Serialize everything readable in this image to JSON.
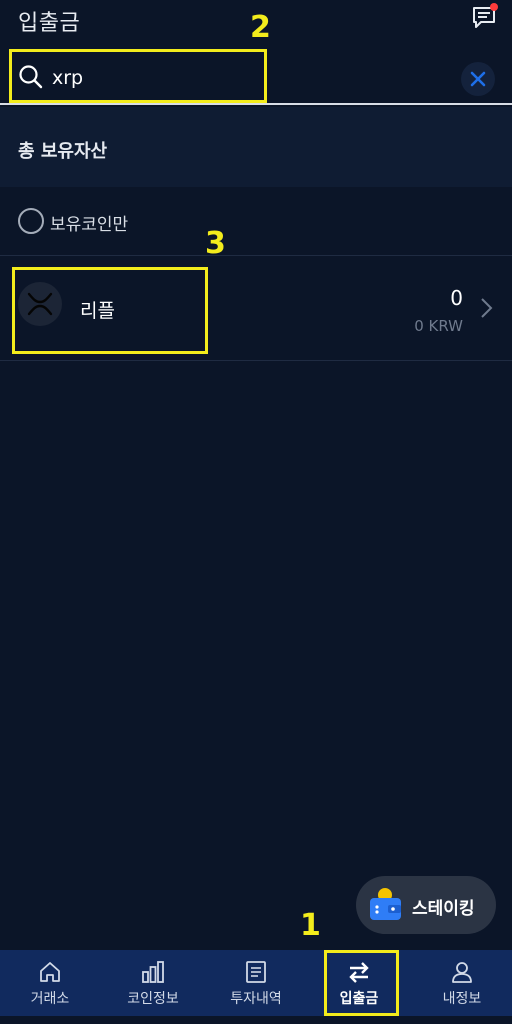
{
  "header": {
    "title": "입출금",
    "chat_icon": "chat-icon",
    "notification_color": "#ff3b3b"
  },
  "search": {
    "value": "xrp",
    "placeholder": "",
    "clear_icon": "close-icon"
  },
  "total": {
    "label": "총 보유자산"
  },
  "filter": {
    "label": "보유코인만",
    "checked": false
  },
  "coins": [
    {
      "name": "리플",
      "amount": "0",
      "krw": "0 KRW",
      "logo_icon": "xrp-logo-icon"
    }
  ],
  "staking": {
    "label": "스테이킹",
    "icon": "wallet-icon"
  },
  "nav": {
    "items": [
      {
        "label": "거래소",
        "icon": "home-icon"
      },
      {
        "label": "코인정보",
        "icon": "bar-chart-icon"
      },
      {
        "label": "투자내역",
        "icon": "document-icon"
      },
      {
        "label": "입출금",
        "icon": "transfer-icon",
        "active": true
      },
      {
        "label": "내정보",
        "icon": "user-icon"
      }
    ]
  },
  "annotations": [
    {
      "label": "1"
    },
    {
      "label": "2"
    },
    {
      "label": "3"
    }
  ],
  "colors": {
    "background": "#0b1528",
    "panel": "#0f1c33",
    "nav": "#112a5e",
    "annotation": "#f3ec1c",
    "accent": "#1e6fe8"
  }
}
